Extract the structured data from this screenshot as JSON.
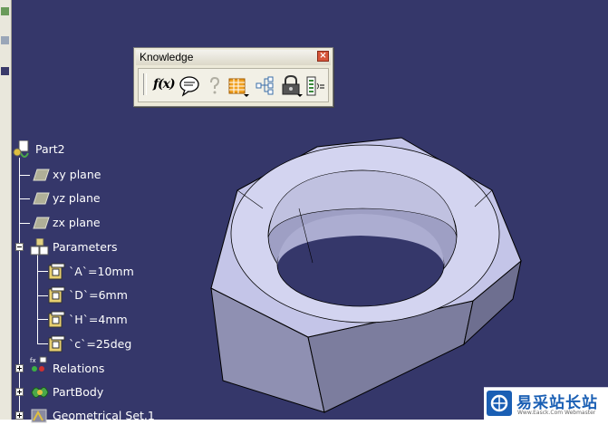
{
  "toolbar": {
    "title": "Knowledge",
    "buttons": [
      {
        "name": "formula-icon",
        "label": "f(x)"
      },
      {
        "name": "comment-icon"
      },
      {
        "name": "help-icon"
      },
      {
        "name": "design-table-icon"
      },
      {
        "name": "knowledge-inspector-icon"
      },
      {
        "name": "lock-icon"
      },
      {
        "name": "equivalent-dimensions-icon"
      }
    ]
  },
  "tree": {
    "root": "Part2",
    "planes": [
      "xy plane",
      "yz plane",
      "zx plane"
    ],
    "parameters_label": "Parameters",
    "parameters": [
      "`A`=10mm",
      "`D`=6mm",
      "`H`=4mm",
      "`c`=25deg"
    ],
    "relations_label": "Relations",
    "partbody_label": "PartBody",
    "geoset_label": "Geometrical Set.1"
  },
  "watermark": {
    "title": "易采站长站",
    "subtitle": "Www.Easck.Com Webmaster"
  },
  "colors": {
    "viewport_bg": "#35376a",
    "part_face": "#c5c5e6",
    "part_side": "#8e8eb0"
  }
}
